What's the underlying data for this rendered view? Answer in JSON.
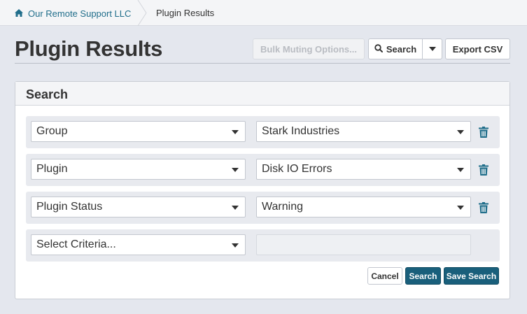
{
  "breadcrumb": {
    "home_label": "Our Remote Support LLC",
    "current_label": "Plugin Results"
  },
  "page": {
    "title": "Plugin Results"
  },
  "toolbar": {
    "bulk_muting_label": "Bulk Muting Options...",
    "search_label": "Search",
    "export_label": "Export CSV"
  },
  "search_panel": {
    "title": "Search",
    "rows": [
      {
        "criteria": "Group",
        "value": "Stark Industries"
      },
      {
        "criteria": "Plugin",
        "value": "Disk IO Errors"
      },
      {
        "criteria": "Plugin Status",
        "value": "Warning"
      }
    ],
    "new_row": {
      "criteria_placeholder": "Select Criteria..."
    },
    "cancel_label": "Cancel",
    "search_label": "Search",
    "save_search_label": "Save Search"
  },
  "colors": {
    "link": "#1f6d8a",
    "primary_button": "#195f7b",
    "page_background": "#e4e7ee"
  }
}
